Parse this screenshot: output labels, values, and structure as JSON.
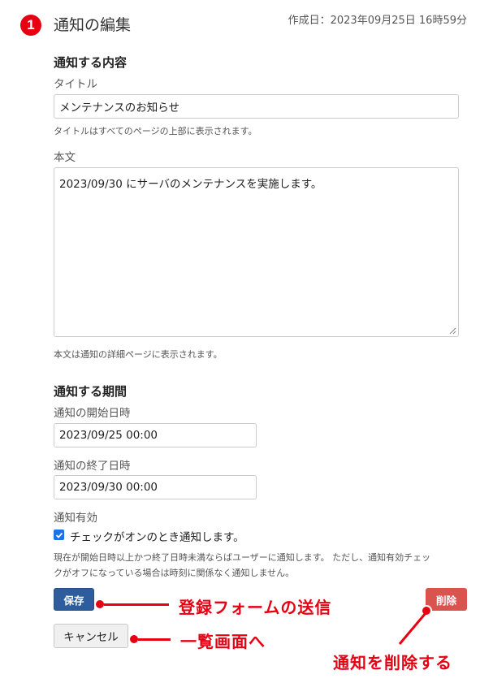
{
  "step_number": "1",
  "page_title": "通知の編集",
  "created_at": "作成日：2023年09月25日 16時59分",
  "content_section": {
    "heading": "通知する内容",
    "title_label": "タイトル",
    "title_value": "メンテナンスのお知らせ",
    "title_help": "タイトルはすべてのページの上部に表示されます。",
    "body_label": "本文",
    "body_value": "2023/09/30 にサーバのメンテナンスを実施します。",
    "body_help": "本文は通知の詳細ページに表示されます。"
  },
  "period_section": {
    "heading": "通知する期間",
    "start_label": "通知の開始日時",
    "start_value": "2023/09/25 00:00",
    "end_label": "通知の終了日時",
    "end_value": "2023/09/30 00:00",
    "enabled_label": "通知有効",
    "checkbox_label": "チェックがオンのとき通知します。",
    "checkbox_checked": true,
    "help_line1": "現在が開始日時以上かつ終了日時未満ならばユーザーに通知します。 ただし、通知有効チェッ",
    "help_line2": "クがオフになっている場合は時刻に関係なく通知しません。"
  },
  "buttons": {
    "save": "保存",
    "delete": "削除",
    "cancel": "キャンセル"
  },
  "annotations": {
    "save": "登録フォームの送信",
    "cancel": "一覧画面へ",
    "delete": "通知を削除する"
  },
  "colors": {
    "accent_red": "#e60012",
    "save_blue": "#2d5d9c",
    "delete_red": "#d9534f"
  }
}
